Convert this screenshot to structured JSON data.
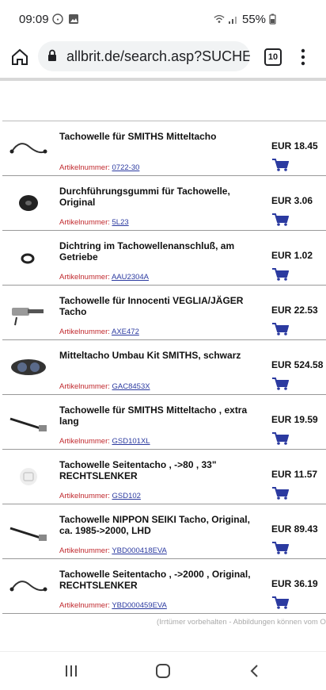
{
  "status_bar": {
    "time": "09:09",
    "battery": "55%"
  },
  "browser": {
    "url": "allbrit.de/search.asp?SUCHE",
    "tab_count": "10"
  },
  "products": [
    {
      "title": "Tachowelle für SMITHS Mitteltacho",
      "price": "EUR 18.45",
      "sku_label": "Artikelnummer:",
      "sku": "0722-30",
      "thumb": "cable"
    },
    {
      "title": "Durchführungsgummi für Tachowelle, Original",
      "price": "EUR 3.06",
      "sku_label": "Artikelnummer:",
      "sku": "5L23",
      "thumb": "grommet"
    },
    {
      "title": "Dichtring im Tachowellenanschluß, am Getriebe",
      "price": "EUR 1.02",
      "sku_label": "Artikelnummer:",
      "sku": "AAU2304A",
      "thumb": "ring"
    },
    {
      "title": "Tachowelle für Innocenti VEGLIA/JÄGER Tacho",
      "price": "EUR 22.53",
      "sku_label": "Artikelnummer:",
      "sku": "AXE472",
      "thumb": "connector"
    },
    {
      "title": "Mitteltacho Umbau Kit SMITHS, schwarz",
      "price": "EUR 524.58",
      "sku_label": "Artikelnummer:",
      "sku": "GAC8453X",
      "thumb": "kit"
    },
    {
      "title": "Tachowelle für SMITHS Mitteltacho , extra lang",
      "price": "EUR 19.59",
      "sku_label": "Artikelnummer:",
      "sku": "GSD101XL",
      "thumb": "rod"
    },
    {
      "title": "Tachowelle Seitentacho , ->80 , 33\" RECHTSLENKER",
      "price": "EUR 11.57",
      "sku_label": "Artikelnummer:",
      "sku": "GSD102",
      "thumb": "placeholder"
    },
    {
      "title": "Tachowelle NIPPON SEIKI Tacho, Original, ca. 1985->2000, LHD",
      "price": "EUR 89.43",
      "sku_label": "Artikelnummer:",
      "sku": "YBD000418EVA",
      "thumb": "rod"
    },
    {
      "title": "Tachowelle Seitentacho , ->2000 , Original, RECHTSLENKER",
      "price": "EUR 36.19",
      "sku_label": "Artikelnummer:",
      "sku": "YBD000459EVA",
      "thumb": "cable"
    }
  ],
  "footer_note": "(Irrtümer vorbehalten - Abbildungen können vom Origi",
  "colors": {
    "accent": "#2b3aa0",
    "sku_label": "#c0282d"
  }
}
